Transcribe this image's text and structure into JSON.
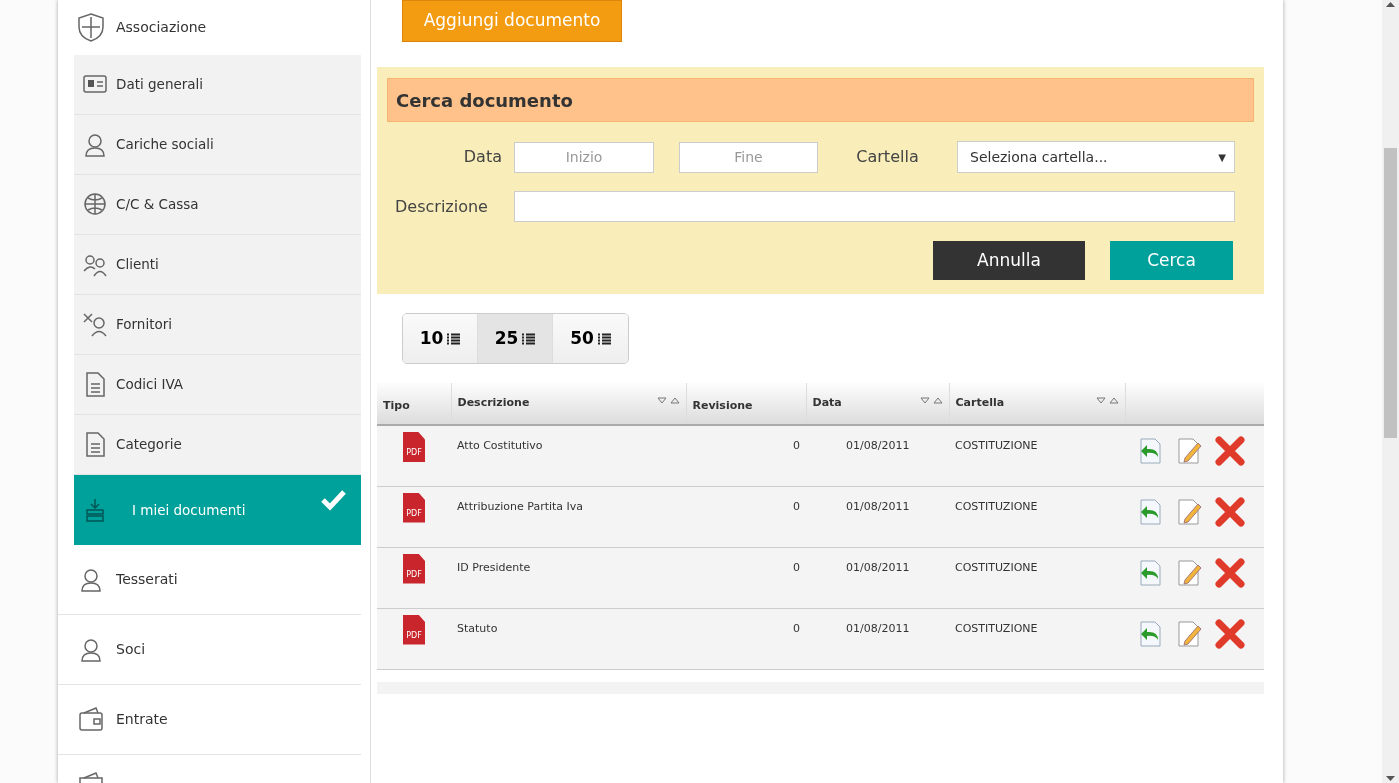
{
  "sidebar": {
    "header": {
      "label": "Associazione"
    },
    "items": [
      {
        "label": "Dati generali",
        "kind": "sub",
        "selected": false
      },
      {
        "label": "Cariche sociali",
        "kind": "sub",
        "selected": false
      },
      {
        "label": "C/C & Cassa",
        "kind": "sub",
        "selected": false
      },
      {
        "label": "Clienti",
        "kind": "sub",
        "selected": false
      },
      {
        "label": "Fornitori",
        "kind": "sub",
        "selected": false
      },
      {
        "label": "Codici IVA",
        "kind": "sub",
        "selected": false
      },
      {
        "label": "Categorie",
        "kind": "sub",
        "selected": false
      },
      {
        "label": "I miei documenti",
        "kind": "sub",
        "selected": true
      },
      {
        "label": "Tesserati",
        "kind": "top",
        "selected": false
      },
      {
        "label": "Soci",
        "kind": "top",
        "selected": false
      },
      {
        "label": "Entrate",
        "kind": "top",
        "selected": false
      }
    ]
  },
  "add_button": "Aggiungi documento",
  "search_panel": {
    "title": "Cerca documento",
    "date_label": "Data",
    "start_placeholder": "Inizio",
    "end_placeholder": "Fine",
    "folder_label": "Cartella",
    "folder_value": "Seleziona cartella...",
    "folder_caret": "▼",
    "description_label": "Descrizione",
    "cancel_button": "Annulla",
    "search_button": "Cerca"
  },
  "page_sizes": [
    {
      "label": "10",
      "selected": false
    },
    {
      "label": "25",
      "selected": true
    },
    {
      "label": "50",
      "selected": false
    }
  ],
  "table": {
    "columns": [
      {
        "label": "Tipo",
        "sortable": false
      },
      {
        "label": "Descrizione",
        "sortable": true
      },
      {
        "label": "Revisione",
        "sortable": false
      },
      {
        "label": "Data",
        "sortable": true
      },
      {
        "label": "Cartella",
        "sortable": true
      }
    ],
    "rows": [
      {
        "type_label": "PDF",
        "description": "Atto Costitutivo",
        "revision": "0",
        "date": "01/08/2011",
        "folder": "COSTITUZIONE"
      },
      {
        "type_label": "PDF",
        "description": "Attribuzione Partita Iva",
        "revision": "0",
        "date": "01/08/2011",
        "folder": "COSTITUZIONE"
      },
      {
        "type_label": "PDF",
        "description": "ID Presidente",
        "revision": "0",
        "date": "01/08/2011",
        "folder": "COSTITUZIONE"
      },
      {
        "type_label": "PDF",
        "description": "Statuto",
        "revision": "0",
        "date": "01/08/2011",
        "folder": "COSTITUZIONE"
      }
    ]
  }
}
